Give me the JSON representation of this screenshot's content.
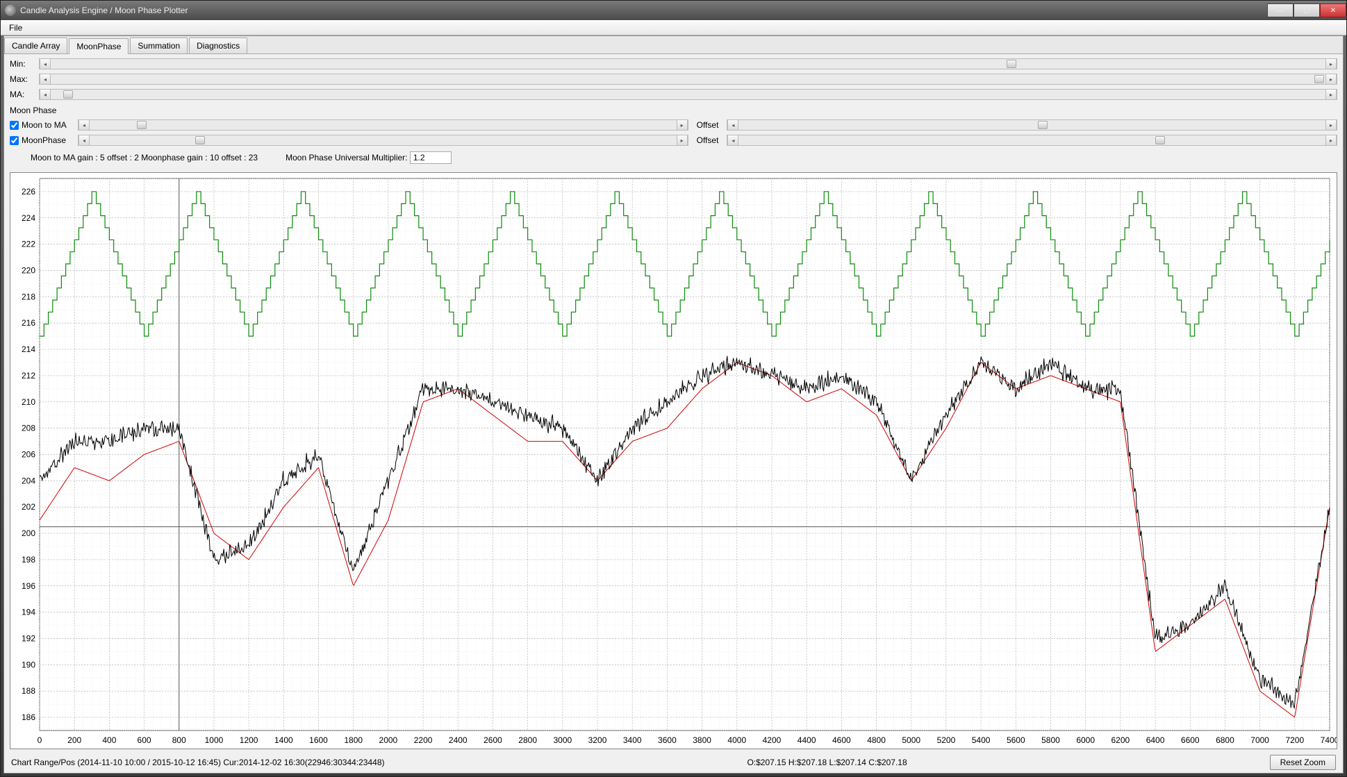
{
  "window": {
    "title": "Candle Analysis Engine / Moon Phase Plotter"
  },
  "menubar": {
    "file": "File"
  },
  "tabs": [
    "Candle Array",
    "MoonPhase",
    "Summation",
    "Diagnostics"
  ],
  "active_tab": 1,
  "sliders": {
    "min_label": "Min:",
    "max_label": "Max:",
    "ma_label": "MA:"
  },
  "moonphase": {
    "section_label": "Moon Phase",
    "moon_to_ma_label": "Moon to MA",
    "moon_to_ma_checked": true,
    "moonphase_label": "MoonPhase",
    "moonphase_checked": true,
    "offset_label": "Offset",
    "params_text": "Moon to MA gain : 5 offset : 2 Moonphase gain : 10 offset : 23",
    "multiplier_label": "Moon Phase Universal Multiplier:",
    "multiplier_value": "1.2"
  },
  "statusbar": {
    "range_text": "Chart Range/Pos (2014-11-10 10:00 / 2015-10-12 16:45) Cur:2014-12-02 16:30(22946:30344:23448)",
    "ohlc_text": "O:$207.15 H:$207.18 L:$207.14 C:$207.18",
    "reset_zoom": "Reset Zoom"
  },
  "chart_data": {
    "type": "line",
    "xlabel": "",
    "ylabel": "",
    "xlim": [
      0,
      7400
    ],
    "ylim": [
      185,
      227
    ],
    "x_ticks": [
      0,
      200,
      400,
      600,
      800,
      1000,
      1200,
      1400,
      1600,
      1800,
      2000,
      2200,
      2400,
      2600,
      2800,
      3000,
      3200,
      3400,
      3600,
      3800,
      4000,
      4200,
      4400,
      4600,
      4800,
      5000,
      5200,
      5400,
      5600,
      5800,
      6000,
      6200,
      6400,
      6600,
      6800,
      7000,
      7200,
      7400
    ],
    "y_ticks": [
      186,
      188,
      190,
      192,
      194,
      196,
      198,
      200,
      202,
      204,
      206,
      208,
      210,
      212,
      214,
      216,
      218,
      220,
      222,
      224,
      226
    ],
    "series": [
      {
        "name": "MoonPhase (green, periodic stepped wave ~216–226, period ~600 samples)",
        "color": "#0a8a0a",
        "period": 600,
        "low": 215,
        "high": 226
      },
      {
        "name": "Moon to MA (red, smoothed price-like line)",
        "color": "#d00000",
        "x": [
          0,
          200,
          400,
          600,
          800,
          1000,
          1200,
          1400,
          1600,
          1800,
          2000,
          2200,
          2400,
          2600,
          2800,
          3000,
          3200,
          3400,
          3600,
          3800,
          4000,
          4200,
          4400,
          4600,
          4800,
          5000,
          5200,
          5400,
          5600,
          5800,
          6000,
          6200,
          6400,
          6600,
          6800,
          7000,
          7200,
          7400
        ],
        "values": [
          201,
          205,
          204,
          206,
          207,
          200,
          198,
          202,
          205,
          196,
          201,
          210,
          211,
          209,
          207,
          207,
          204,
          207,
          208,
          211,
          213,
          212,
          210,
          211,
          209,
          204,
          208,
          213,
          211,
          212,
          211,
          210,
          191,
          193,
          195,
          188,
          186,
          202
        ]
      },
      {
        "name": "Price (black, noisy close series)",
        "color": "#000000",
        "x": [
          0,
          200,
          400,
          600,
          800,
          1000,
          1200,
          1400,
          1600,
          1800,
          2000,
          2200,
          2400,
          2600,
          2800,
          3000,
          3200,
          3400,
          3600,
          3800,
          4000,
          4200,
          4400,
          4600,
          4800,
          5000,
          5200,
          5400,
          5600,
          5800,
          6000,
          6200,
          6400,
          6600,
          6800,
          7000,
          7200,
          7400
        ],
        "values": [
          204,
          207,
          207,
          208,
          208,
          198,
          199,
          204,
          206,
          197,
          204,
          211,
          211,
          210,
          209,
          208,
          204,
          208,
          210,
          212,
          213,
          212,
          211,
          212,
          210,
          204,
          209,
          213,
          211,
          213,
          211,
          211,
          192,
          193,
          196,
          189,
          187,
          202
        ]
      }
    ]
  }
}
